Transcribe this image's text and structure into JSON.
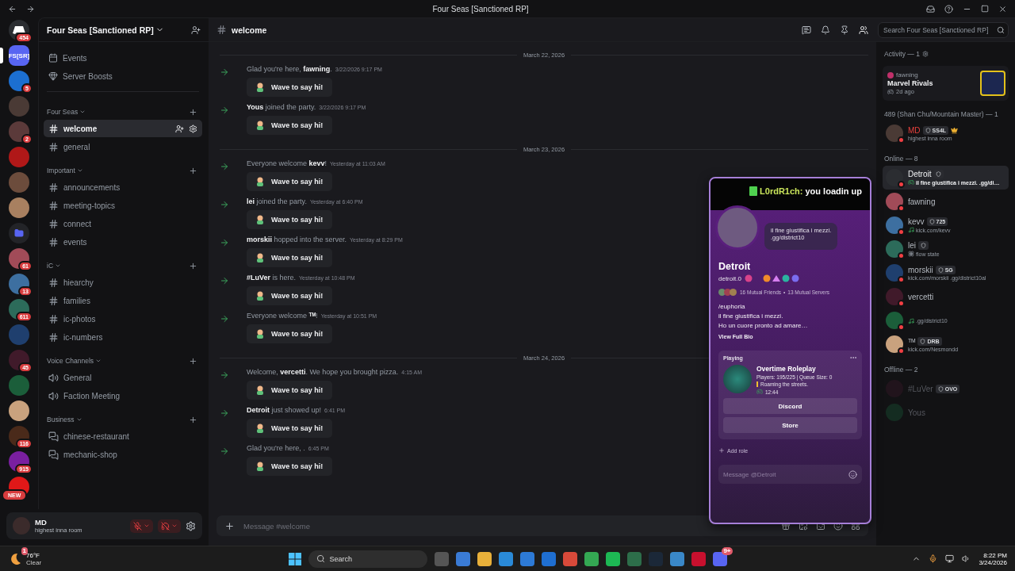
{
  "window": {
    "title": "Four Seas [Sanctioned RP]"
  },
  "rail": {
    "home_badge": "454",
    "servers": [
      {
        "kind": "text",
        "label": "FS[SR]",
        "selected": true
      },
      {
        "kind": "photo",
        "badge": "5",
        "selected": false
      },
      {
        "kind": "photo",
        "selected": false
      },
      {
        "kind": "photo",
        "badge": "2",
        "selected": false
      },
      {
        "kind": "photo",
        "selected": false
      },
      {
        "kind": "photo",
        "selected": false
      },
      {
        "kind": "photo",
        "selected": false
      },
      {
        "kind": "folder",
        "selected": false
      },
      {
        "kind": "photo",
        "badge": "61",
        "selected": false
      },
      {
        "kind": "photo",
        "badge": "13",
        "selected": false
      },
      {
        "kind": "photo",
        "badge": "611",
        "selected": false
      },
      {
        "kind": "photo",
        "selected": false
      },
      {
        "kind": "photo",
        "badge": "45",
        "selected": false
      },
      {
        "kind": "photo",
        "selected": false
      },
      {
        "kind": "photo",
        "selected": false
      },
      {
        "kind": "photo",
        "badge": "116",
        "selected": false
      },
      {
        "kind": "photo",
        "badge": "915",
        "selected": false
      },
      {
        "kind": "photo",
        "badge": "NEW",
        "selected": false
      }
    ]
  },
  "sidebar": {
    "server_name": "Four Seas [Sanctioned RP]",
    "shortcuts": [
      {
        "kind": "events",
        "label": "Events"
      },
      {
        "kind": "boosts",
        "label": "Server Boosts"
      }
    ],
    "categories": [
      {
        "name": "Four Seas",
        "channels": [
          {
            "name": "welcome",
            "kind": "text",
            "selected": true
          },
          {
            "name": "general",
            "kind": "text",
            "selected": false
          }
        ]
      },
      {
        "name": "Important",
        "channels": [
          {
            "name": "announcements",
            "kind": "text",
            "selected": false
          },
          {
            "name": "meeting-topics",
            "kind": "text",
            "selected": false
          },
          {
            "name": "connect",
            "kind": "text",
            "selected": false
          },
          {
            "name": "events",
            "kind": "text",
            "selected": false
          }
        ]
      },
      {
        "name": "iC",
        "channels": [
          {
            "name": "hiearchy",
            "kind": "text",
            "selected": false
          },
          {
            "name": "families",
            "kind": "text",
            "selected": false
          },
          {
            "name": "ic-photos",
            "kind": "text",
            "selected": false
          },
          {
            "name": "ic-numbers",
            "kind": "text",
            "selected": false
          }
        ]
      },
      {
        "name": "Voice Channels",
        "channels": [
          {
            "name": "General",
            "kind": "voice",
            "selected": false
          },
          {
            "name": "Faction Meeting",
            "kind": "voice",
            "selected": false
          }
        ]
      },
      {
        "name": "Business",
        "channels": [
          {
            "name": "chinese-restaurant",
            "kind": "forum",
            "selected": false
          },
          {
            "name": "mechanic-shop",
            "kind": "forum",
            "selected": false
          }
        ]
      }
    ]
  },
  "user": {
    "name": "MD",
    "status": "highest inna room"
  },
  "header": {
    "channel": "welcome",
    "placeholder": "Search Four Seas [Sanctioned RP]"
  },
  "days": [
    {
      "date": "March 22, 2026",
      "messages": [
        {
          "text": "Glad you're here, **fawning**.",
          "time": "3/22/2026 9:17 PM",
          "button": "Wave to say hi!"
        },
        {
          "text": "**Yous** joined the party.",
          "time": "3/22/2026 9:17 PM",
          "button": "Wave to say hi!"
        }
      ]
    },
    {
      "date": "March 23, 2026",
      "messages": [
        {
          "text": "Everyone welcome **kevv**!",
          "time": "Yesterday at 11:03 AM",
          "button": "Wave to say hi!"
        },
        {
          "text": "**lei** joined the party.",
          "time": "Yesterday at 6:40 PM",
          "button": "Wave to say hi!"
        },
        {
          "text": "**morskii** hopped into the server.",
          "time": "Yesterday at 8:29 PM",
          "button": "Wave to say hi!"
        },
        {
          "text": "**#LuVer** is here.",
          "time": "Yesterday at 10:48 PM",
          "button": "Wave to say hi!"
        },
        {
          "text": "Everyone welcome **ᵀᴹ**!",
          "time": "Yesterday at 10:51 PM",
          "button": "Wave to say hi!"
        }
      ]
    },
    {
      "date": "March 24, 2026",
      "messages": [
        {
          "text": "Welcome, **vercetti**. We hope you brought pizza.",
          "time": "4:15 AM",
          "button": "Wave to say hi!"
        },
        {
          "text": "**Detroit** just showed up!",
          "time": "6:41 PM",
          "button": "Wave to say hi!"
        },
        {
          "text": "Glad you're here, .",
          "time": "6:45 PM",
          "button": "Wave to say hi!"
        }
      ]
    }
  ],
  "composer": {
    "placeholder": "Message #welcome"
  },
  "profile": {
    "banner_user": "L0rdR1ch:",
    "banner_text": "you loadin up",
    "status_lines": [
      "il fine giustifica i mezzi.",
      ".gg/district10"
    ],
    "display_name": "Detroit",
    "username": "detroit.0",
    "mutual_friends": "16 Mutual Friends",
    "separator": "•",
    "mutual_servers": "13 Mutual Servers",
    "bio_lines": [
      "/euphoria",
      "il fine giustifica i mezzi.",
      "Ho un cuore pronto ad amare…"
    ],
    "bio_link": "View Full Bio",
    "activity": {
      "heading": "Playing",
      "name": "Overtime Roleplay",
      "details": [
        "Players: 195/225 | Queue Size: 0",
        "Roaming the streets."
      ],
      "elapsed": "12:44"
    },
    "buttons": [
      "Discord",
      "Store"
    ],
    "add_role": "Add role",
    "placeholder": "Message @Detroit"
  },
  "members": {
    "activity_title": "Activity — 1",
    "activity": {
      "user": "fawning",
      "game": "Marvel Rivals",
      "time": "2d ago"
    },
    "groups": [
      {
        "title": "489 (Shan Chu/Mountain Master) — 1",
        "offline": false,
        "members": [
          {
            "name": "MD",
            "color": "#e8413d",
            "guild_tag": true,
            "tag": "SS4L",
            "owner": true,
            "kind": "plain",
            "status": "highest inna room",
            "selected": false
          }
        ]
      },
      {
        "title": "Online — 8",
        "offline": false,
        "members": [
          {
            "name": "Detroit",
            "guild_tag": true,
            "owner": false,
            "kind": "game",
            "status": "il fine giustifica i mezzi. .gg/di…",
            "selected": true
          },
          {
            "name": "fawning",
            "guild_tag": false,
            "owner": false,
            "selected": false
          },
          {
            "name": "kevv",
            "guild_tag": true,
            "tag": "725",
            "owner": false,
            "kind": "music",
            "status": "kick.com/kevv",
            "selected": false
          },
          {
            "name": "lei",
            "guild_tag": true,
            "owner": false,
            "kind": "flower",
            "status": "flow state",
            "selected": false
          },
          {
            "name": "morskii",
            "guild_tag": true,
            "tag": "SG",
            "owner": false,
            "kind": "plain",
            "status": "kick.com/morskii .gg/district10al",
            "selected": false
          },
          {
            "name": "vercetti",
            "guild_tag": false,
            "owner": false,
            "selected": false
          },
          {
            "guild_tag": false,
            "owner": false,
            "kind": "music",
            "status": ".gg/district10",
            "selected": false
          },
          {
            "name": "ᵀᴹ",
            "guild_tag": true,
            "tag": "DRB",
            "owner": false,
            "kind": "plain",
            "status": "kick.com/Nesmondd",
            "selected": false
          }
        ]
      },
      {
        "title": "Offline — 2",
        "offline": true,
        "members": [
          {
            "name": "#LuVer",
            "guild_tag": true,
            "tag": "OVO",
            "owner": false,
            "selected": false
          },
          {
            "name": "Yous",
            "guild_tag": false,
            "owner": false,
            "selected": false
          }
        ]
      }
    ]
  },
  "taskbar": {
    "weather_badge": "1",
    "temperature": "76°F",
    "weather": "Clear",
    "search": "Search",
    "app_badge": "9+",
    "time": "8:22 PM",
    "date": "3/24/2026"
  }
}
